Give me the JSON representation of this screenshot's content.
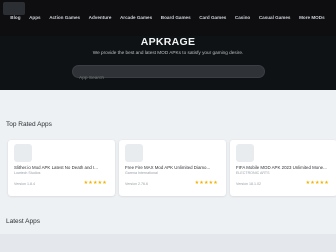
{
  "nav": {
    "items": [
      "Blog",
      "Apps",
      "Action Games",
      "Adventure",
      "Arcade Games",
      "Board Games",
      "Card Games",
      "Casino",
      "Casual Games",
      "More MODs"
    ]
  },
  "hero": {
    "title": "APKRAGE",
    "subtitle": "We provide the best and latest MOD APKs to satisfy your gaming desire.",
    "search_placeholder": "App Search"
  },
  "sections": {
    "top_rated": "Top Rated Apps",
    "latest": "Latest Apps"
  },
  "top_apps": [
    {
      "title": "Slither.io Mod APK Latest No Death and I...",
      "developer": "Lowtech Studios",
      "version": "Version 1.8.4",
      "stars": "★★★★★"
    },
    {
      "title": "Free Fire MAX Mod APK Unlimited Diamo...",
      "developer": "Garena International",
      "version": "Version 2.76.6",
      "stars": "★★★★★"
    },
    {
      "title": "FIFA Mobile MOD APK 2023 Unlimited Mone...",
      "developer": "ELECTRONIC ARTS",
      "version": "Version 18.1.02",
      "stars": "★★★★★"
    }
  ],
  "colors": {
    "navbar": "#0e0e10",
    "hero": "#0f1214",
    "page_bg": "#eef1f4",
    "star": "#f0b400"
  }
}
